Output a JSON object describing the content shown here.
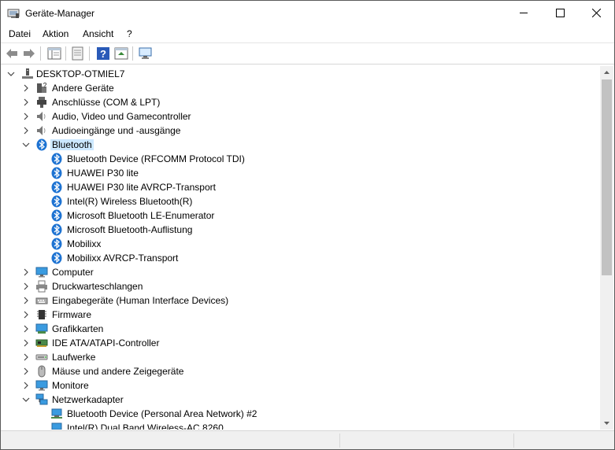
{
  "window": {
    "title": "Geräte-Manager"
  },
  "menu": [
    "Datei",
    "Aktion",
    "Ansicht",
    "?"
  ],
  "tree": {
    "root": "DESKTOP-OTMIEL7",
    "categories": [
      "Andere Geräte",
      "Anschlüsse (COM & LPT)",
      "Audio, Video und Gamecontroller",
      "Audioeingänge und -ausgänge",
      "Bluetooth",
      "Computer",
      "Druckwarteschlangen",
      "Eingabegeräte (Human Interface Devices)",
      "Firmware",
      "Grafikkarten",
      "IDE ATA/ATAPI-Controller",
      "Laufwerke",
      "Mäuse und andere Zeigegeräte",
      "Monitore",
      "Netzwerkadapter"
    ],
    "bluetooth_devices": [
      "Bluetooth Device (RFCOMM Protocol TDI)",
      "HUAWEI P30 lite",
      "HUAWEI P30 lite AVRCP-Transport",
      "Intel(R) Wireless Bluetooth(R)",
      "Microsoft Bluetooth LE-Enumerator",
      "Microsoft Bluetooth-Auflistung",
      "Mobilixx",
      "Mobilixx AVRCP-Transport"
    ],
    "network_devices": [
      "Bluetooth Device (Personal Area Network) #2",
      "Intel(R) Dual Band Wireless-AC 8260"
    ]
  },
  "colors": {
    "selection": "#cce8ff",
    "bluetooth_blue": "#1e73d2",
    "title_bar": "#ffffff"
  }
}
